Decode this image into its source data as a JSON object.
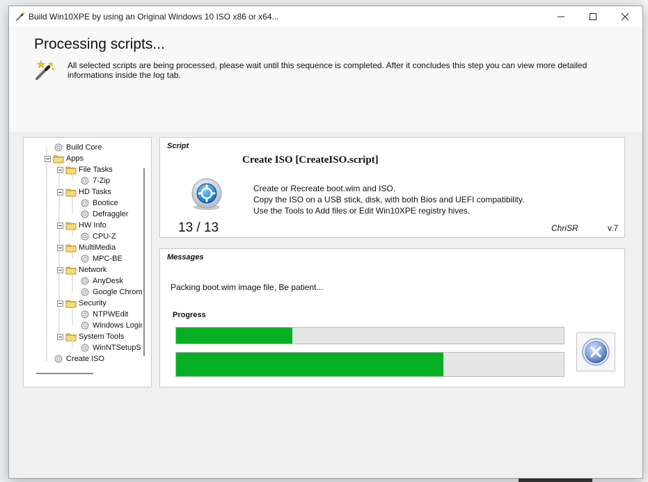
{
  "window": {
    "title": "Build Win10XPE by using an Original Windows 10 ISO x86 or x64...",
    "controls": {
      "minimize": "—",
      "maximize": "☐",
      "close": "✕"
    }
  },
  "header": {
    "heading": "Processing scripts...",
    "description": "All selected scripts are being processed, please wait until this sequence is completed. After it concludes this step you can view more detailed informations inside the log tab."
  },
  "tree": {
    "items": [
      {
        "label": "Build Core",
        "type": "script",
        "level": 1
      },
      {
        "label": "Apps",
        "type": "folder",
        "level": 1
      },
      {
        "label": "File Tasks",
        "type": "folder",
        "level": 2
      },
      {
        "label": "7-Zip",
        "type": "script",
        "level": 3
      },
      {
        "label": "HD Tasks",
        "type": "folder",
        "level": 2
      },
      {
        "label": "Bootice",
        "type": "script",
        "level": 3
      },
      {
        "label": "Defraggler",
        "type": "script",
        "level": 3
      },
      {
        "label": "HW Info",
        "type": "folder",
        "level": 2
      },
      {
        "label": "CPU-Z",
        "type": "script",
        "level": 3
      },
      {
        "label": "MultiMedia",
        "type": "folder",
        "level": 2
      },
      {
        "label": "MPC-BE",
        "type": "script",
        "level": 3
      },
      {
        "label": "Network",
        "type": "folder",
        "level": 2
      },
      {
        "label": "AnyDesk",
        "type": "script",
        "level": 3
      },
      {
        "label": "Google Chrome",
        "type": "script",
        "level": 3
      },
      {
        "label": "Security",
        "type": "folder",
        "level": 2
      },
      {
        "label": "NTPWEdit",
        "type": "script",
        "level": 3
      },
      {
        "label": "Windows Login Unlocker",
        "type": "script",
        "level": 3
      },
      {
        "label": "System Tools",
        "type": "folder",
        "level": 2
      },
      {
        "label": "WinNTSetupS",
        "type": "script",
        "level": 3
      },
      {
        "label": "Create ISO",
        "type": "script",
        "level": 1
      }
    ]
  },
  "script": {
    "section_label": "Script",
    "title": "Create ISO [CreateISO.script]",
    "description_lines": [
      "Create or Recreate boot.wim and ISO.",
      "Copy the ISO on a USB stick, disk, with both Bios and UEFI compatibility.",
      "Use the Tools to Add files or Edit Win10XPE registry hives."
    ],
    "counter": "13 / 13",
    "author": "ChriSR",
    "version": "v.7"
  },
  "messages": {
    "section_label": "Messages",
    "text": "Packing boot.wim image file, Be patient...",
    "progress_label": "Progress",
    "progress_script_fraction": 0.3,
    "progress_total_fraction": 0.69
  },
  "colors": {
    "progress_fill": "#06b025",
    "progress_track": "#e6e6e6",
    "folder": "#f2c94c",
    "cancel_accent": "#4a78c2"
  },
  "icons": {
    "app": "magic-wand-icon",
    "header": "magic-wand-stars-icon",
    "script": "blue-gear-disc-icon",
    "cancel": "x-circle-icon"
  }
}
